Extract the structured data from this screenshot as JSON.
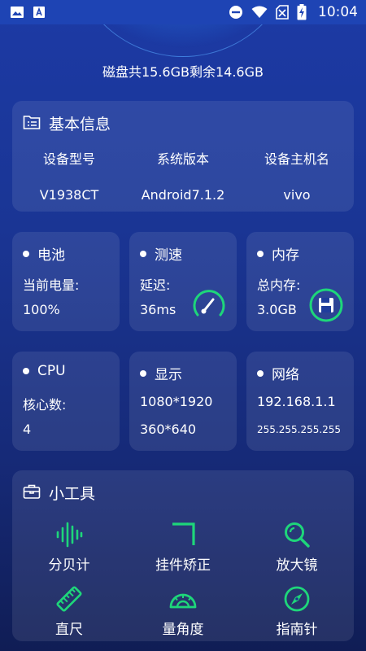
{
  "status_bar": {
    "time": "10:04",
    "icons_left": [
      "image-icon",
      "a-icon"
    ],
    "icons_right": [
      "do-not-disturb-icon",
      "wifi-icon",
      "no-sim-icon",
      "battery-charging-icon"
    ]
  },
  "disk": {
    "summary": "磁盘共15.6GB剩余14.6GB"
  },
  "basic_info": {
    "title": "基本信息",
    "headers": [
      "设备型号",
      "系统版本",
      "设备主机名"
    ],
    "values": [
      "V1938CT",
      "Android7.1.2",
      "vivo"
    ]
  },
  "battery": {
    "title": "电池",
    "label": "当前电量:",
    "value": "100%"
  },
  "speed": {
    "title": "测速",
    "label": "延迟:",
    "value": "36ms"
  },
  "memory": {
    "title": "内存",
    "label": "总内存:",
    "value": "3.0GB"
  },
  "cpu": {
    "title": "CPU",
    "label": "核心数:",
    "value": "4"
  },
  "display": {
    "title": "显示",
    "resolution": "1080*1920",
    "dp": "360*640"
  },
  "network": {
    "title": "网络",
    "ip": "192.168.1.1",
    "mask": "255.255.255.255"
  },
  "tools": {
    "title": "小工具",
    "items": [
      {
        "label": "分贝计",
        "icon": "decibel-meter-icon"
      },
      {
        "label": "挂件矫正",
        "icon": "corner-level-icon"
      },
      {
        "label": "放大镜",
        "icon": "magnifier-icon"
      },
      {
        "label": "直尺",
        "icon": "ruler-icon"
      },
      {
        "label": "量角度",
        "icon": "protractor-icon"
      },
      {
        "label": "指南针",
        "icon": "compass-icon"
      }
    ]
  },
  "colors": {
    "accent": "#1ed67a",
    "card_bg": "#2a4aa6",
    "status_bar": "#1e44b4"
  }
}
